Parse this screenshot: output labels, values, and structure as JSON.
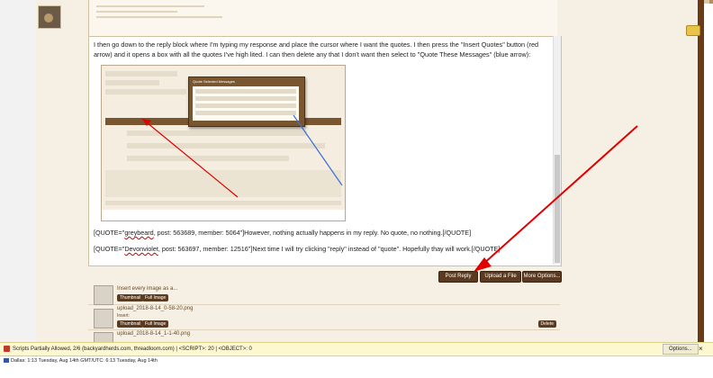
{
  "post": {
    "intro": "I then go down to the reply block where I'm typing my response and place the cursor where I want the quotes. I then press the \"Insert Quotes\" button (red arrow) and it opens a box with all the quotes I've high lited. I can then delete any that I don't want then select to \"Quote These Messages\" (blue arrow):",
    "quote1_prefix": "[QUOTE=\"",
    "quote1_user": "greybeard",
    "quote1_rest": ", post: 563689, member: 5064\"]However, nothing actually happens in my reply. No quote, no nothing.[/QUOTE]",
    "quote2_prefix": "[QUOTE=\"",
    "quote2_user": "Devonviolet",
    "quote2_rest": ", post: 563697, member: 12516\"]Next time I will try clicking \"reply\" instead of \"quote\". Hopefully thay will work.[/QUOTE]"
  },
  "screenshot_thumb": {
    "window_title": "Quote Selected Messages"
  },
  "toolbar": {
    "post_reply": "Post Reply",
    "upload_file": "Upload a File",
    "more_options": "More Options..."
  },
  "attachments": [
    {
      "name": "Insert every image as a...",
      "thumb_btn": "Thumbnail",
      "full_btn": "Full Image"
    },
    {
      "name": "upload_2018-8-14_0-58-20.png",
      "sub": "Insert:",
      "thumb_btn": "Thumbnail",
      "full_btn": "Full Image",
      "delete_btn": "Delete"
    },
    {
      "name": "upload_2018-8-14_1-1-40.png"
    }
  ],
  "notification": {
    "text": "Scripts Partially Allowed, 2/6 (backyardherds.com, threadloom.com) | <SCRIPT>: 20 | <OBJECT>: 0",
    "options": "Options...",
    "close": "×"
  },
  "statusbar": {
    "text": "Dallas: 1:13 Tuesday, Aug 14th    GMT/UTC: 6:13 Tuesday, Aug 14th"
  },
  "colors": {
    "frame": "#6b3a16",
    "button": "#5a3a20",
    "red_arrow": "#e00000",
    "blue_arrow": "#3a6fd8"
  }
}
